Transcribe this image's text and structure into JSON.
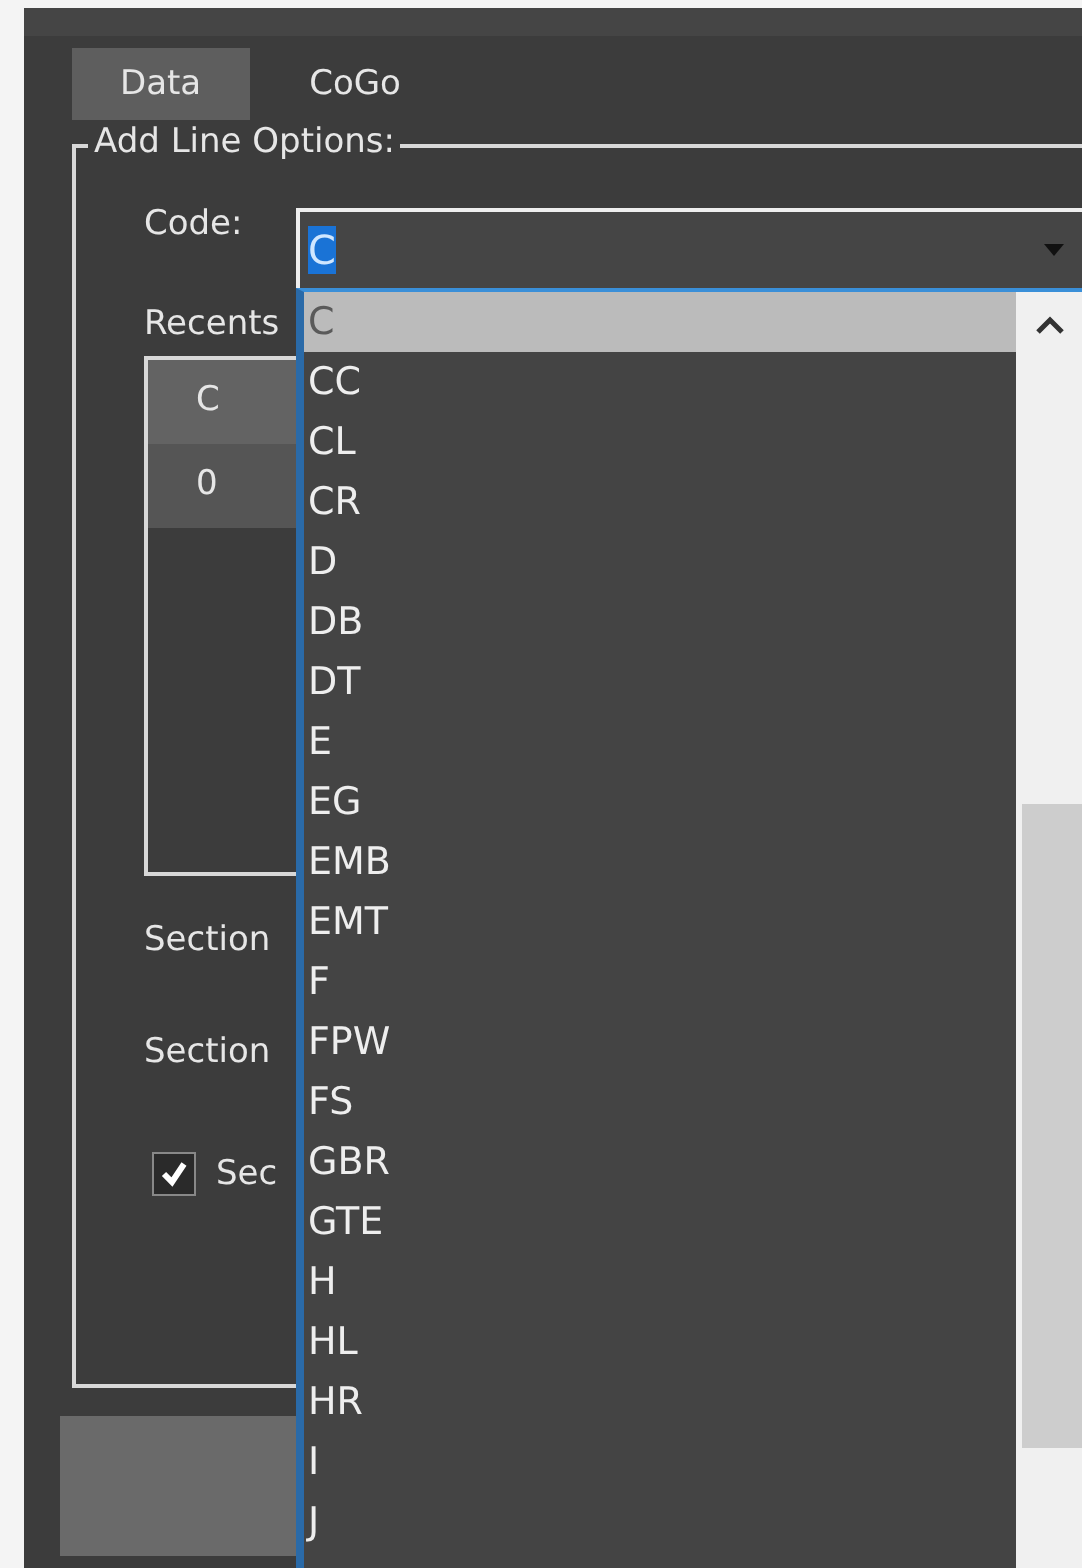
{
  "tabs": [
    {
      "label": "Data",
      "selected": true
    },
    {
      "label": "CoGo",
      "selected": false
    }
  ],
  "group": {
    "title": "Add Line Options:",
    "code": {
      "label": "Code:",
      "value": "C",
      "expanded": true
    },
    "recents": {
      "label": "Recents",
      "rows": [
        {
          "value": "C",
          "selected": true
        },
        {
          "value": "0",
          "selected": false
        }
      ]
    },
    "section_labels": [
      "Section",
      "Section"
    ],
    "checkbox": {
      "label": "Sec",
      "checked": true
    }
  },
  "dropdown": {
    "items": [
      {
        "label": "C",
        "selected": true
      },
      {
        "label": "CC",
        "selected": false
      },
      {
        "label": "CL",
        "selected": false
      },
      {
        "label": "CR",
        "selected": false
      },
      {
        "label": "D",
        "selected": false
      },
      {
        "label": "DB",
        "selected": false
      },
      {
        "label": "DT",
        "selected": false
      },
      {
        "label": "E",
        "selected": false
      },
      {
        "label": "EG",
        "selected": false
      },
      {
        "label": "EMB",
        "selected": false
      },
      {
        "label": "EMT",
        "selected": false
      },
      {
        "label": "F",
        "selected": false
      },
      {
        "label": "FPW",
        "selected": false
      },
      {
        "label": "FS",
        "selected": false
      },
      {
        "label": "GBR",
        "selected": false
      },
      {
        "label": "GTE",
        "selected": false
      },
      {
        "label": "H",
        "selected": false
      },
      {
        "label": "HL",
        "selected": false
      },
      {
        "label": "HR",
        "selected": false
      },
      {
        "label": "I",
        "selected": false
      },
      {
        "label": "J",
        "selected": false
      }
    ]
  }
}
